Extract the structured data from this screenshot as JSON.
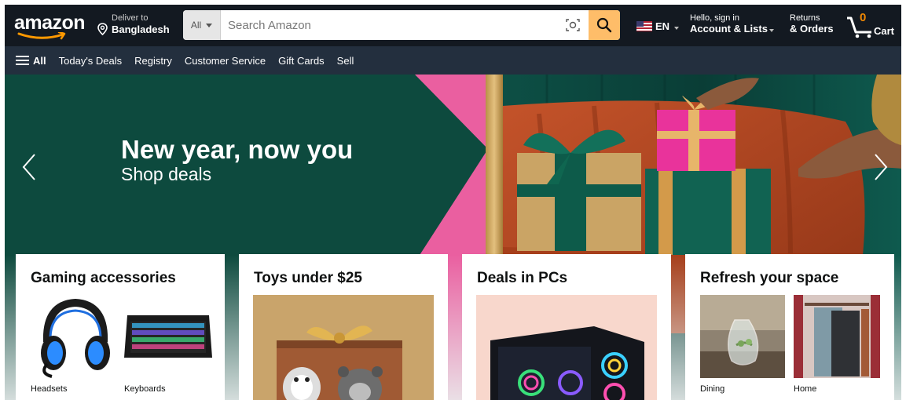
{
  "header": {
    "logo_text": "amazon",
    "deliver_label": "Deliver to",
    "deliver_location": "Bangladesh",
    "search_category": "All",
    "search_placeholder": "Search Amazon",
    "language": "EN",
    "account_greeting": "Hello, sign in",
    "account_label": "Account & Lists",
    "returns_label": "Returns",
    "orders_label": "& Orders",
    "cart_count": "0",
    "cart_label": "Cart"
  },
  "subnav": {
    "all_label": "All",
    "items": [
      "Today's Deals",
      "Registry",
      "Customer Service",
      "Gift Cards",
      "Sell"
    ]
  },
  "hero": {
    "headline": "New year, now you",
    "subheadline": "Shop deals"
  },
  "cards": [
    {
      "title": "Gaming accessories",
      "captions": [
        "Headsets",
        "Keyboards"
      ]
    },
    {
      "title": "Toys under $25"
    },
    {
      "title": "Deals in PCs"
    },
    {
      "title": "Refresh your space",
      "captions": [
        "Dining",
        "Home"
      ]
    }
  ],
  "colors": {
    "nav_bg": "#131921",
    "subnav_bg": "#232f3e",
    "search_button": "#febd69",
    "hero_green": "#0d4a3e",
    "hero_pink": "#ea5fa0",
    "cart_count": "#f08804"
  }
}
